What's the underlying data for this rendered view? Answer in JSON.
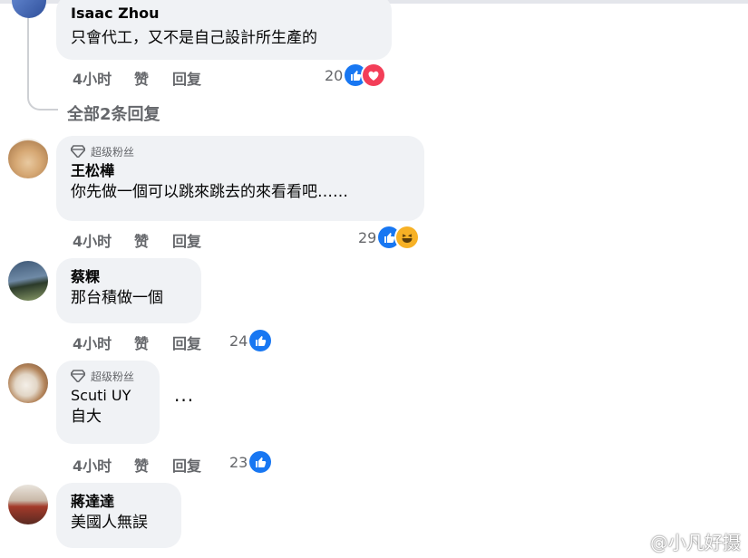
{
  "actions": {
    "like": "赞",
    "reply": "回复"
  },
  "view_all_replies": "全部2条回复",
  "watermark": "@小凡好摄",
  "comments": [
    {
      "author": "Isaac Zhou",
      "text": "只會代工，又不是自己設計所生產的",
      "time": "4小时",
      "reactions": 20,
      "reaction_icons": [
        "like-icon",
        "love-icon"
      ]
    },
    {
      "badge": "超级粉丝",
      "author": "王松樺",
      "text": "你先做一個可以跳來跳去的來看看吧……",
      "time": "4小时",
      "reactions": 29,
      "reaction_icons": [
        "like-icon",
        "haha-icon"
      ]
    },
    {
      "author": "蔡粿",
      "text": "那台積做一個",
      "time": "4小时",
      "reactions": 24,
      "reaction_icons": [
        "like-icon"
      ]
    },
    {
      "badge": "超级粉丝",
      "author": "Scuti UY",
      "text": "自大",
      "time": "4小时",
      "reactions": 23,
      "reaction_icons": [
        "like-icon"
      ],
      "more": "···"
    },
    {
      "author": "蔣達達",
      "text": "美國人無誤"
    }
  ],
  "colors": {
    "bubble": "#f0f2f5",
    "like": "#1877f2",
    "love": "#f33e58",
    "haha": "#f7b125",
    "meta": "#65676b"
  }
}
